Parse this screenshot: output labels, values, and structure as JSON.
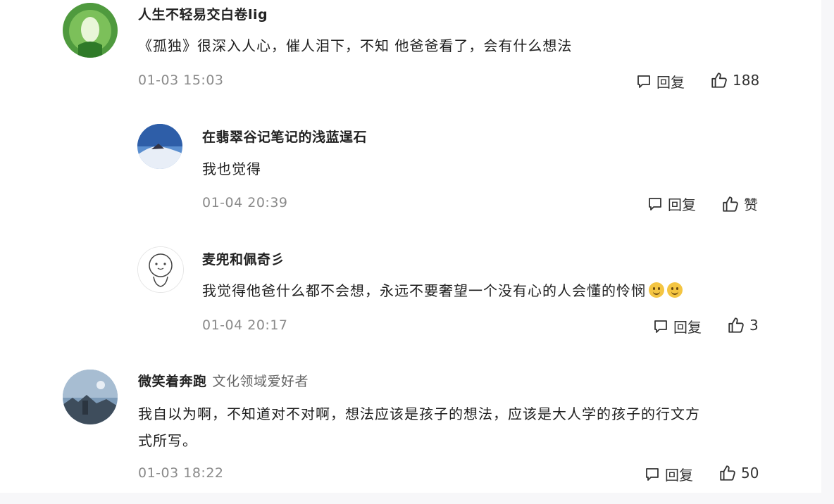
{
  "comments": [
    {
      "user": "人生不轻易交白卷lig",
      "text": "《孤独》很深入人心，催人泪下，不知 他爸爸看了，会有什么想法",
      "time": "01-03 15:03",
      "reply_label": "回复",
      "likes": "188",
      "replies": [
        {
          "user": "在翡翠谷记笔记的浅蓝逞石",
          "text": "我也觉得",
          "time": "01-04 20:39",
          "reply_label": "回复",
          "likes": "赞"
        },
        {
          "user": "麦兜和佩奇彡",
          "text": "我觉得他爸什么都不会想，永远不要奢望一个没有心的人会懂的怜悯",
          "emoji": "smile-emoji",
          "time": "01-04 20:17",
          "reply_label": "回复",
          "likes": "3"
        }
      ]
    },
    {
      "user": "微笑着奔跑",
      "user_tag": "文化领域爱好者",
      "text_line1": "我自以为啊，不知道对不对啊，想法应该是孩子的想法，应该是大人学的孩子的行文方",
      "text_line2": "式所写。",
      "time": "01-03 18:22",
      "reply_label": "回复",
      "likes": "50"
    }
  ],
  "icons": {
    "comment": "speech-bubble-icon",
    "like": "thumbs-up-icon"
  },
  "colors": {
    "time": "#8a8a8a",
    "text": "#1e1e1e",
    "background": "#ffffff"
  }
}
